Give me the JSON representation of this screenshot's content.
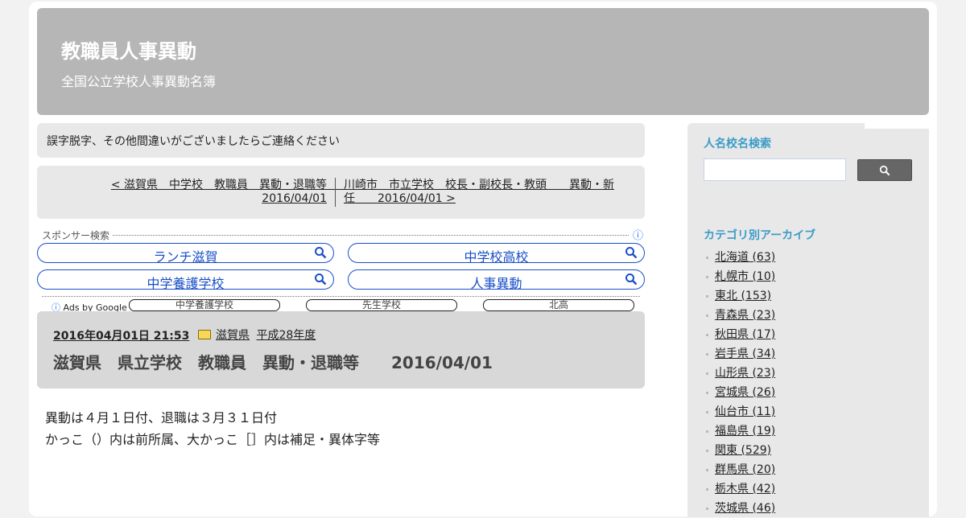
{
  "site": {
    "title": "教職員人事異動",
    "description": "全国公立学校人事異動名簿"
  },
  "notice": "誤字脱字、その他間違いがございましたらご連絡ください",
  "post_nav": {
    "prev": "< 滋賀県　中学校　教職員　異動・退職等　　2016/04/01",
    "next": "川崎市　市立学校　校長・副校長・教頭　　異動・新任　　2016/04/01 >"
  },
  "ads": {
    "label": "スポンサー検索",
    "info_icon": "info-icon",
    "buttons": [
      "ランチ滋賀",
      "中学校高校",
      "中学養護学校",
      "人事異動"
    ],
    "ads_by": "Ads by Google",
    "small_links": [
      "中学養護学校",
      "先生学校",
      "北高"
    ],
    "accent": "#1a4fc7"
  },
  "post": {
    "date": "2016年04月01日 21:53",
    "categories": [
      "滋賀県",
      "平成28年度"
    ],
    "title": "滋賀県　県立学校　教職員　異動・退職等　　2016/04/01",
    "body": [
      "異動は４月１日付、退職は３月３１日付",
      "かっこ（）内は前所属、大かっこ［］内は補足・異体字等"
    ]
  },
  "sidebar": {
    "search_heading": "人名校名検索",
    "search_placeholder": "",
    "archive_heading": "カテゴリ別アーカイブ",
    "categories": [
      "北海道 (63)",
      "札幌市 (10)",
      "東北 (153)",
      "青森県 (23)",
      "秋田県 (17)",
      "岩手県 (34)",
      "山形県 (23)",
      "宮城県 (26)",
      "仙台市 (11)",
      "福島県 (19)",
      "関東 (529)",
      "群馬県 (20)",
      "栃木県 (42)",
      "茨城県 (46)"
    ],
    "heading_color": "#3b9cc7"
  }
}
